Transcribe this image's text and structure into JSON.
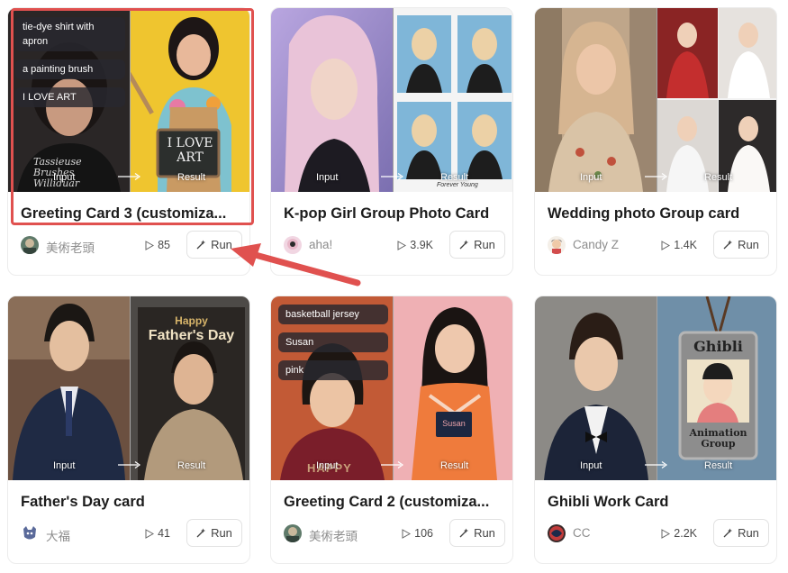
{
  "labels": {
    "input": "Input",
    "result": "Result"
  },
  "cards": [
    {
      "title": "Greeting Card 3 (customiza...",
      "author": "美術老頭",
      "runs": "85",
      "run_label": "Run",
      "chips": [
        "tie-dye shirt with apron",
        "a painting brush",
        "I LOVE ART"
      ],
      "board_text": "I LOVE ART",
      "shirt_text": "Tassieuse Brushes Williduar"
    },
    {
      "title": "K-pop Girl Group Photo Card",
      "author": "aha!",
      "runs": "3.9K",
      "run_label": "Run",
      "footer_text": "Forever Young"
    },
    {
      "title": "Wedding photo Group card",
      "author": "Candy Z",
      "runs": "1.4K",
      "run_label": "Run"
    },
    {
      "title": "Father's Day card",
      "author": "大福",
      "runs": "41",
      "run_label": "Run",
      "card_text_1": "Happy",
      "card_text_2": "Father's Day"
    },
    {
      "title": "Greeting Card 2 (customiza...",
      "author": "美術老頭",
      "runs": "106",
      "run_label": "Run",
      "chips": [
        "basketball jersey",
        "Susan",
        "pink"
      ],
      "card_name": "Susan",
      "shirt_text": "HAPPY"
    },
    {
      "title": "Ghibli Work Card",
      "author": "CC",
      "runs": "2.2K",
      "run_label": "Run",
      "badge_title": "Ghibli",
      "badge_caption": "Animation Group"
    }
  ],
  "colors": {
    "highlight": "#e0514f",
    "title": "#1c1c1c",
    "author": "#8d8d8d"
  }
}
